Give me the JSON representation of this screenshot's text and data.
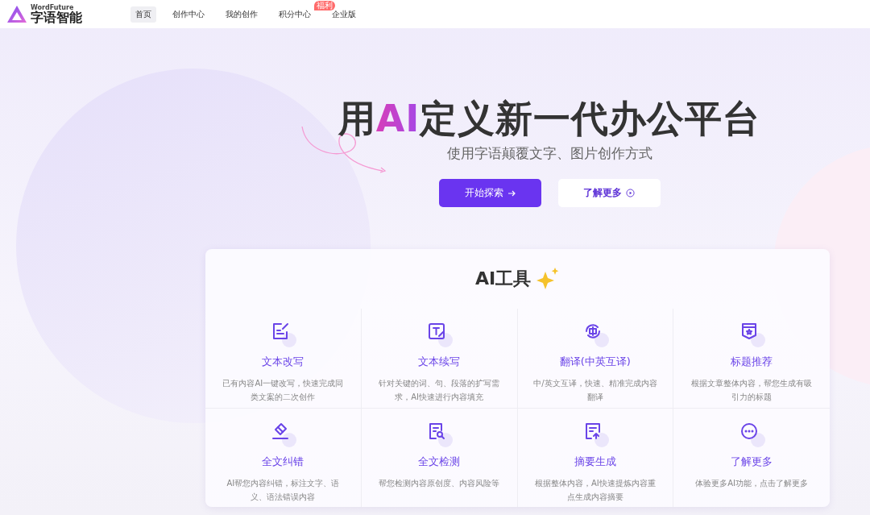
{
  "logo": {
    "name": "字语智能",
    "tagline": "WordFuture"
  },
  "nav": [
    {
      "label": "首页",
      "selected": true
    },
    {
      "label": "创作中心",
      "selected": false
    },
    {
      "label": "我的创作",
      "selected": false
    },
    {
      "label": "积分中心",
      "selected": false,
      "badge": "福利"
    },
    {
      "label": "企业版",
      "selected": false
    }
  ],
  "hero": {
    "title": [
      {
        "text": "用",
        "highlight": false
      },
      {
        "text": "AI",
        "highlight": true
      },
      {
        "text": "定义新一代办公平台",
        "highlight": false
      }
    ],
    "subtitle": "使用字语颠覆文字、图片创作方式",
    "primary_button": "开始探索",
    "secondary_button": "了解更多"
  },
  "tools": {
    "title": "AI工具",
    "items": [
      {
        "kind": "rewrite",
        "name": "文本改写",
        "desc": "已有内容AI一键改写，快速完成同类文案的二次创作"
      },
      {
        "kind": "continue",
        "name": "文本续写",
        "desc": "针对关键的词、句、段落的扩写需求，AI快速进行内容填充"
      },
      {
        "kind": "translate",
        "name": "翻译(中英互译)",
        "desc": "中/英文互译，快速、精准完成内容翻译"
      },
      {
        "kind": "title",
        "name": "标题推荐",
        "desc": "根据文章整体内容，帮您生成有吸引力的标题"
      },
      {
        "kind": "proofread",
        "name": "全文纠错",
        "desc": "AI帮您内容纠错，标注文字、语义、语法错误内容"
      },
      {
        "kind": "detect",
        "name": "全文检测",
        "desc": "帮您检测内容原创度、内容风险等"
      },
      {
        "kind": "summary",
        "name": "摘要生成",
        "desc": "根据整体内容，AI快速提炼内容重点生成内容摘要"
      },
      {
        "kind": "more",
        "name": "了解更多",
        "desc": "体验更多AI功能，点击了解更多"
      }
    ]
  }
}
